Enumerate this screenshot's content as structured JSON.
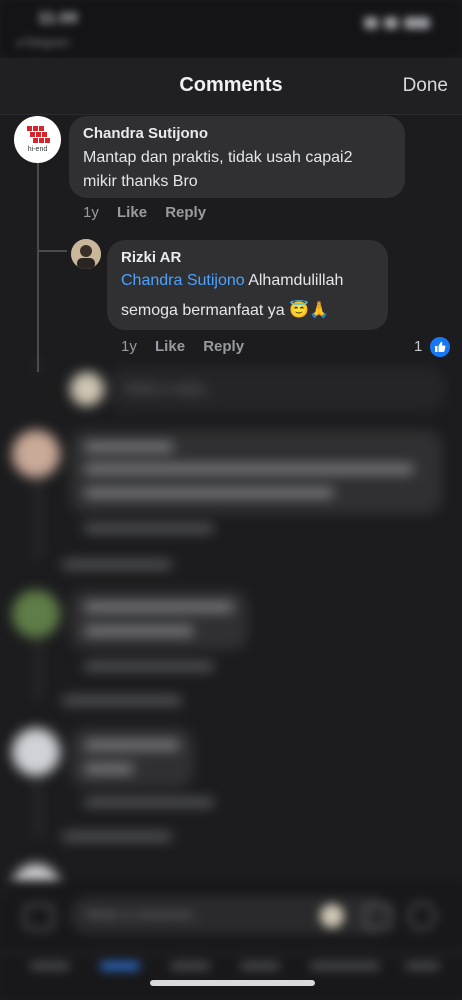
{
  "header": {
    "title": "Comments",
    "done_label": "Done"
  },
  "comments": [
    {
      "author": "Chandra Sutijono",
      "avatar_label": "hi-end",
      "text_line1": "Mantap dan praktis, tidak usah capai2",
      "text_line2": "mikir thanks Bro",
      "age": "1y",
      "like_label": "Like",
      "reply_label": "Reply"
    }
  ],
  "reply": {
    "author": "Rizki AR",
    "mention": "Chandra Sutijono",
    "text_line1": " Alhamdulillah",
    "text_line2": "semoga bermanfaat ya 😇🙏",
    "age": "1y",
    "like_label": "Like",
    "reply_label": "Reply",
    "reaction_count": "1"
  },
  "colors": {
    "background": "#1c1c1e",
    "bubble": "#303032",
    "mention": "#4aa3ff",
    "like_badge": "#1877f2"
  }
}
